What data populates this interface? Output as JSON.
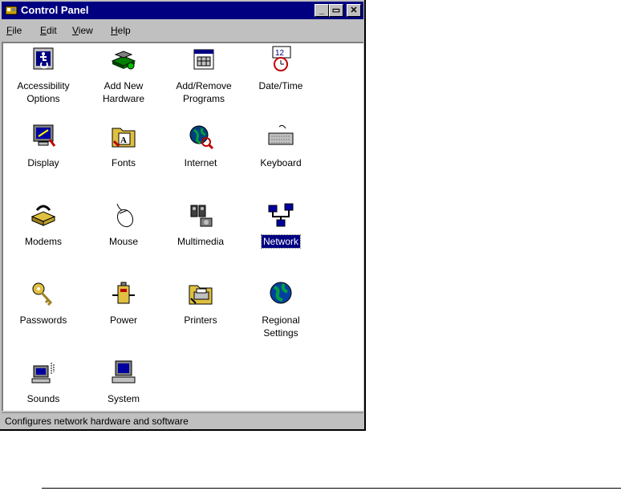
{
  "window": {
    "title": "Control Panel",
    "buttons": {
      "minimize": "_",
      "restore": "▭",
      "close": "✕"
    }
  },
  "menu": [
    {
      "label": "File",
      "mnemonic": "F"
    },
    {
      "label": "Edit",
      "mnemonic": "E"
    },
    {
      "label": "View",
      "mnemonic": "V"
    },
    {
      "label": "Help",
      "mnemonic": "H"
    }
  ],
  "items": [
    {
      "label": "Accessibility Options",
      "icon": "accessibility-icon"
    },
    {
      "label": "Add New Hardware",
      "icon": "add-hardware-icon"
    },
    {
      "label": "Add/Remove Programs",
      "icon": "add-remove-programs-icon"
    },
    {
      "label": "Date/Time",
      "icon": "date-time-icon"
    },
    {
      "label": "Display",
      "icon": "display-icon"
    },
    {
      "label": "Fonts",
      "icon": "fonts-icon"
    },
    {
      "label": "Internet",
      "icon": "internet-icon"
    },
    {
      "label": "Keyboard",
      "icon": "keyboard-icon"
    },
    {
      "label": "Modems",
      "icon": "modem-icon"
    },
    {
      "label": "Mouse",
      "icon": "mouse-icon"
    },
    {
      "label": "Multimedia",
      "icon": "multimedia-icon"
    },
    {
      "label": "Network",
      "icon": "network-icon",
      "selected": true
    },
    {
      "label": "Passwords",
      "icon": "passwords-icon"
    },
    {
      "label": "Power",
      "icon": "power-icon"
    },
    {
      "label": "Printers",
      "icon": "printers-icon"
    },
    {
      "label": "Regional Settings",
      "icon": "regional-settings-icon"
    },
    {
      "label": "Sounds",
      "icon": "sounds-icon"
    },
    {
      "label": "System",
      "icon": "system-icon"
    }
  ],
  "status": {
    "text": "Configures network hardware and software"
  },
  "colors": {
    "titlebar": "#000080",
    "face": "#c0c0c0",
    "selection": "#000080"
  }
}
